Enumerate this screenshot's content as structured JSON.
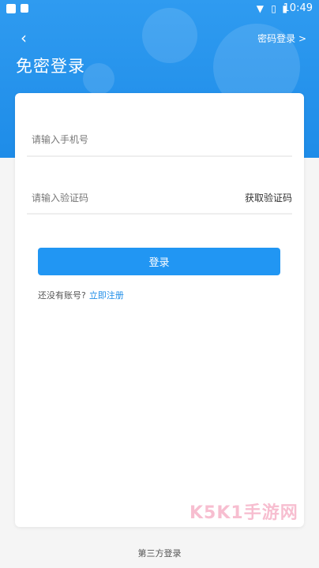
{
  "status_bar": {
    "time": "10:49"
  },
  "header": {
    "back_icon": "chevron-left-icon",
    "password_login": "密码登录 >",
    "title": "免密登录"
  },
  "form": {
    "phone_placeholder": "请输入手机号",
    "code_placeholder": "请输入验证码",
    "get_code": "获取验证码",
    "login_button": "登录",
    "no_account": "还没有账号?",
    "register_now": "立即注册"
  },
  "watermark": "K5K1手游网",
  "footer": {
    "third_party": "第三方登录"
  },
  "colors": {
    "primary": "#2196f3",
    "header": "#1e8ce8"
  }
}
